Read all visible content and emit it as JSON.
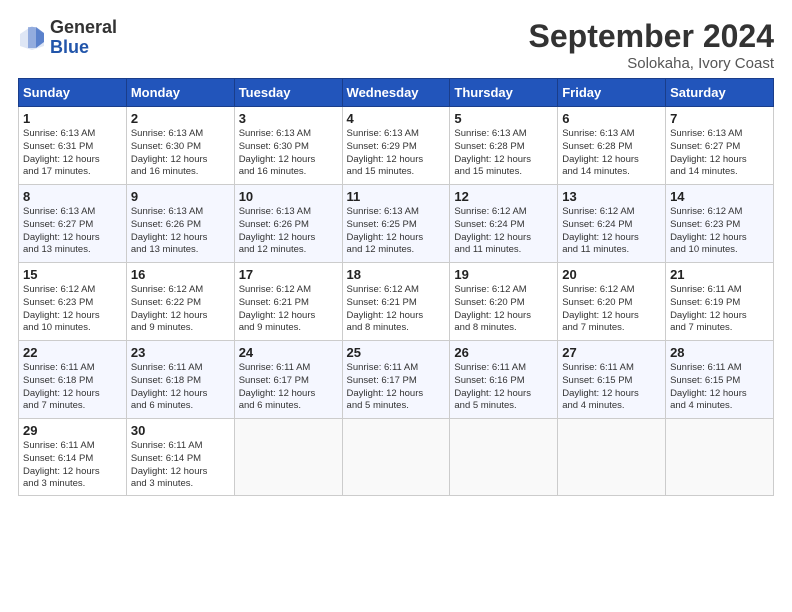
{
  "header": {
    "logo_general": "General",
    "logo_blue": "Blue",
    "month_title": "September 2024",
    "location": "Solokaha, Ivory Coast"
  },
  "days_of_week": [
    "Sunday",
    "Monday",
    "Tuesday",
    "Wednesday",
    "Thursday",
    "Friday",
    "Saturday"
  ],
  "weeks": [
    [
      {
        "day": "1",
        "sunrise": "6:13 AM",
        "sunset": "6:31 PM",
        "daylight": "12 hours and 17 minutes."
      },
      {
        "day": "2",
        "sunrise": "6:13 AM",
        "sunset": "6:30 PM",
        "daylight": "12 hours and 16 minutes."
      },
      {
        "day": "3",
        "sunrise": "6:13 AM",
        "sunset": "6:30 PM",
        "daylight": "12 hours and 16 minutes."
      },
      {
        "day": "4",
        "sunrise": "6:13 AM",
        "sunset": "6:29 PM",
        "daylight": "12 hours and 15 minutes."
      },
      {
        "day": "5",
        "sunrise": "6:13 AM",
        "sunset": "6:28 PM",
        "daylight": "12 hours and 15 minutes."
      },
      {
        "day": "6",
        "sunrise": "6:13 AM",
        "sunset": "6:28 PM",
        "daylight": "12 hours and 14 minutes."
      },
      {
        "day": "7",
        "sunrise": "6:13 AM",
        "sunset": "6:27 PM",
        "daylight": "12 hours and 14 minutes."
      }
    ],
    [
      {
        "day": "8",
        "sunrise": "6:13 AM",
        "sunset": "6:27 PM",
        "daylight": "12 hours and 13 minutes."
      },
      {
        "day": "9",
        "sunrise": "6:13 AM",
        "sunset": "6:26 PM",
        "daylight": "12 hours and 13 minutes."
      },
      {
        "day": "10",
        "sunrise": "6:13 AM",
        "sunset": "6:26 PM",
        "daylight": "12 hours and 12 minutes."
      },
      {
        "day": "11",
        "sunrise": "6:13 AM",
        "sunset": "6:25 PM",
        "daylight": "12 hours and 12 minutes."
      },
      {
        "day": "12",
        "sunrise": "6:12 AM",
        "sunset": "6:24 PM",
        "daylight": "12 hours and 11 minutes."
      },
      {
        "day": "13",
        "sunrise": "6:12 AM",
        "sunset": "6:24 PM",
        "daylight": "12 hours and 11 minutes."
      },
      {
        "day": "14",
        "sunrise": "6:12 AM",
        "sunset": "6:23 PM",
        "daylight": "12 hours and 10 minutes."
      }
    ],
    [
      {
        "day": "15",
        "sunrise": "6:12 AM",
        "sunset": "6:23 PM",
        "daylight": "12 hours and 10 minutes."
      },
      {
        "day": "16",
        "sunrise": "6:12 AM",
        "sunset": "6:22 PM",
        "daylight": "12 hours and 9 minutes."
      },
      {
        "day": "17",
        "sunrise": "6:12 AM",
        "sunset": "6:21 PM",
        "daylight": "12 hours and 9 minutes."
      },
      {
        "day": "18",
        "sunrise": "6:12 AM",
        "sunset": "6:21 PM",
        "daylight": "12 hours and 8 minutes."
      },
      {
        "day": "19",
        "sunrise": "6:12 AM",
        "sunset": "6:20 PM",
        "daylight": "12 hours and 8 minutes."
      },
      {
        "day": "20",
        "sunrise": "6:12 AM",
        "sunset": "6:20 PM",
        "daylight": "12 hours and 7 minutes."
      },
      {
        "day": "21",
        "sunrise": "6:11 AM",
        "sunset": "6:19 PM",
        "daylight": "12 hours and 7 minutes."
      }
    ],
    [
      {
        "day": "22",
        "sunrise": "6:11 AM",
        "sunset": "6:18 PM",
        "daylight": "12 hours and 7 minutes."
      },
      {
        "day": "23",
        "sunrise": "6:11 AM",
        "sunset": "6:18 PM",
        "daylight": "12 hours and 6 minutes."
      },
      {
        "day": "24",
        "sunrise": "6:11 AM",
        "sunset": "6:17 PM",
        "daylight": "12 hours and 6 minutes."
      },
      {
        "day": "25",
        "sunrise": "6:11 AM",
        "sunset": "6:17 PM",
        "daylight": "12 hours and 5 minutes."
      },
      {
        "day": "26",
        "sunrise": "6:11 AM",
        "sunset": "6:16 PM",
        "daylight": "12 hours and 5 minutes."
      },
      {
        "day": "27",
        "sunrise": "6:11 AM",
        "sunset": "6:15 PM",
        "daylight": "12 hours and 4 minutes."
      },
      {
        "day": "28",
        "sunrise": "6:11 AM",
        "sunset": "6:15 PM",
        "daylight": "12 hours and 4 minutes."
      }
    ],
    [
      {
        "day": "29",
        "sunrise": "6:11 AM",
        "sunset": "6:14 PM",
        "daylight": "12 hours and 3 minutes."
      },
      {
        "day": "30",
        "sunrise": "6:11 AM",
        "sunset": "6:14 PM",
        "daylight": "12 hours and 3 minutes."
      },
      null,
      null,
      null,
      null,
      null
    ]
  ]
}
